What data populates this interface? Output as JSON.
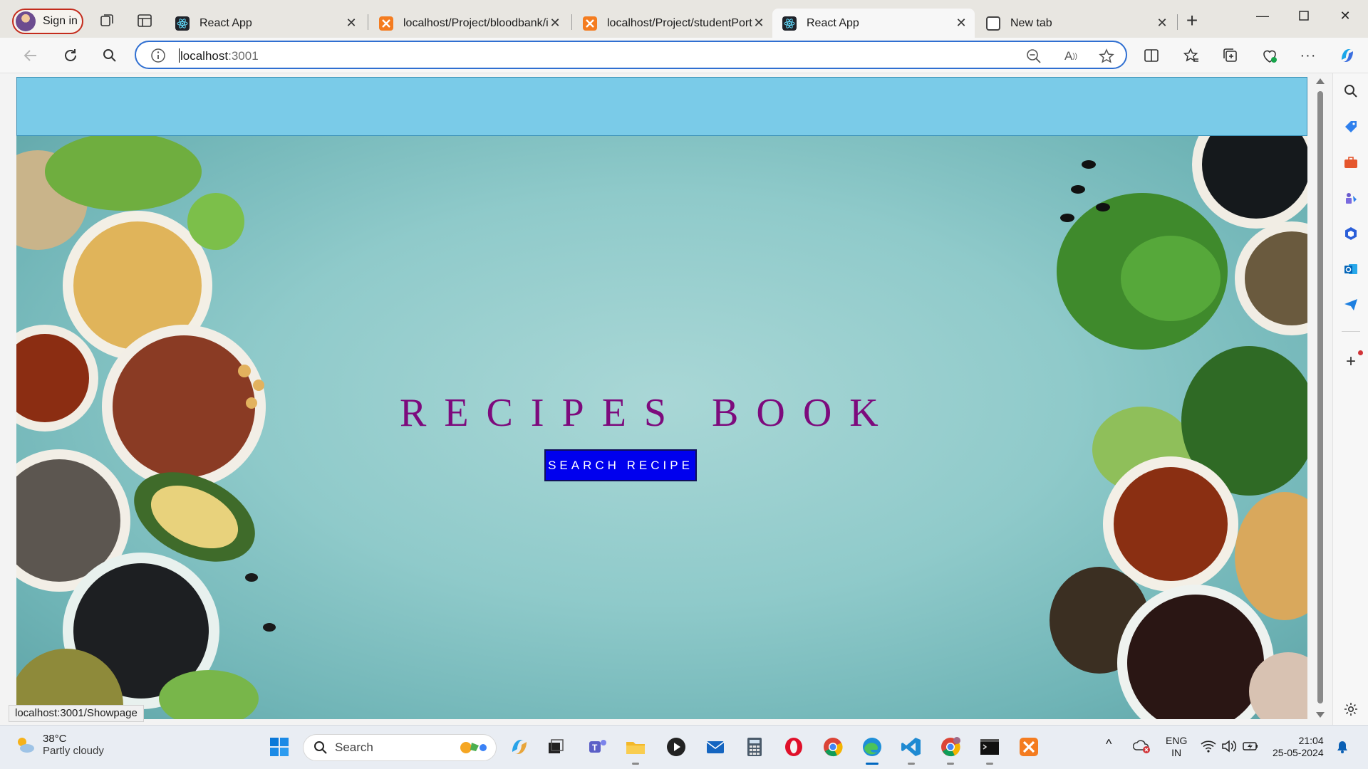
{
  "browser": {
    "signin_label": "Sign in",
    "tabs": [
      {
        "title": "React App",
        "favicon": "react-icon"
      },
      {
        "title": "localhost/Project/bloodbank/in",
        "favicon": "xampp-icon"
      },
      {
        "title": "localhost/Project/studentPorta",
        "favicon": "xampp-icon"
      },
      {
        "title": "React App",
        "favicon": "react-icon",
        "active": true
      },
      {
        "title": "New tab",
        "favicon": "new-tab-icon"
      }
    ],
    "address": {
      "host": "localhost",
      "port": ":3001"
    },
    "status_link": "localhost:3001/Showpage"
  },
  "page": {
    "title": "RECIPES BOOK",
    "button_label": "SEARCH RECIPE",
    "colors": {
      "navbar": "#7acbe8",
      "title": "#7d0a7d",
      "button": "#0000ee"
    }
  },
  "taskbar": {
    "weather_temp": "38°C",
    "weather_cond": "Partly cloudy",
    "search_placeholder": "Search",
    "lang_top": "ENG",
    "lang_bottom": "IN",
    "time": "21:04",
    "date": "25-05-2024"
  }
}
